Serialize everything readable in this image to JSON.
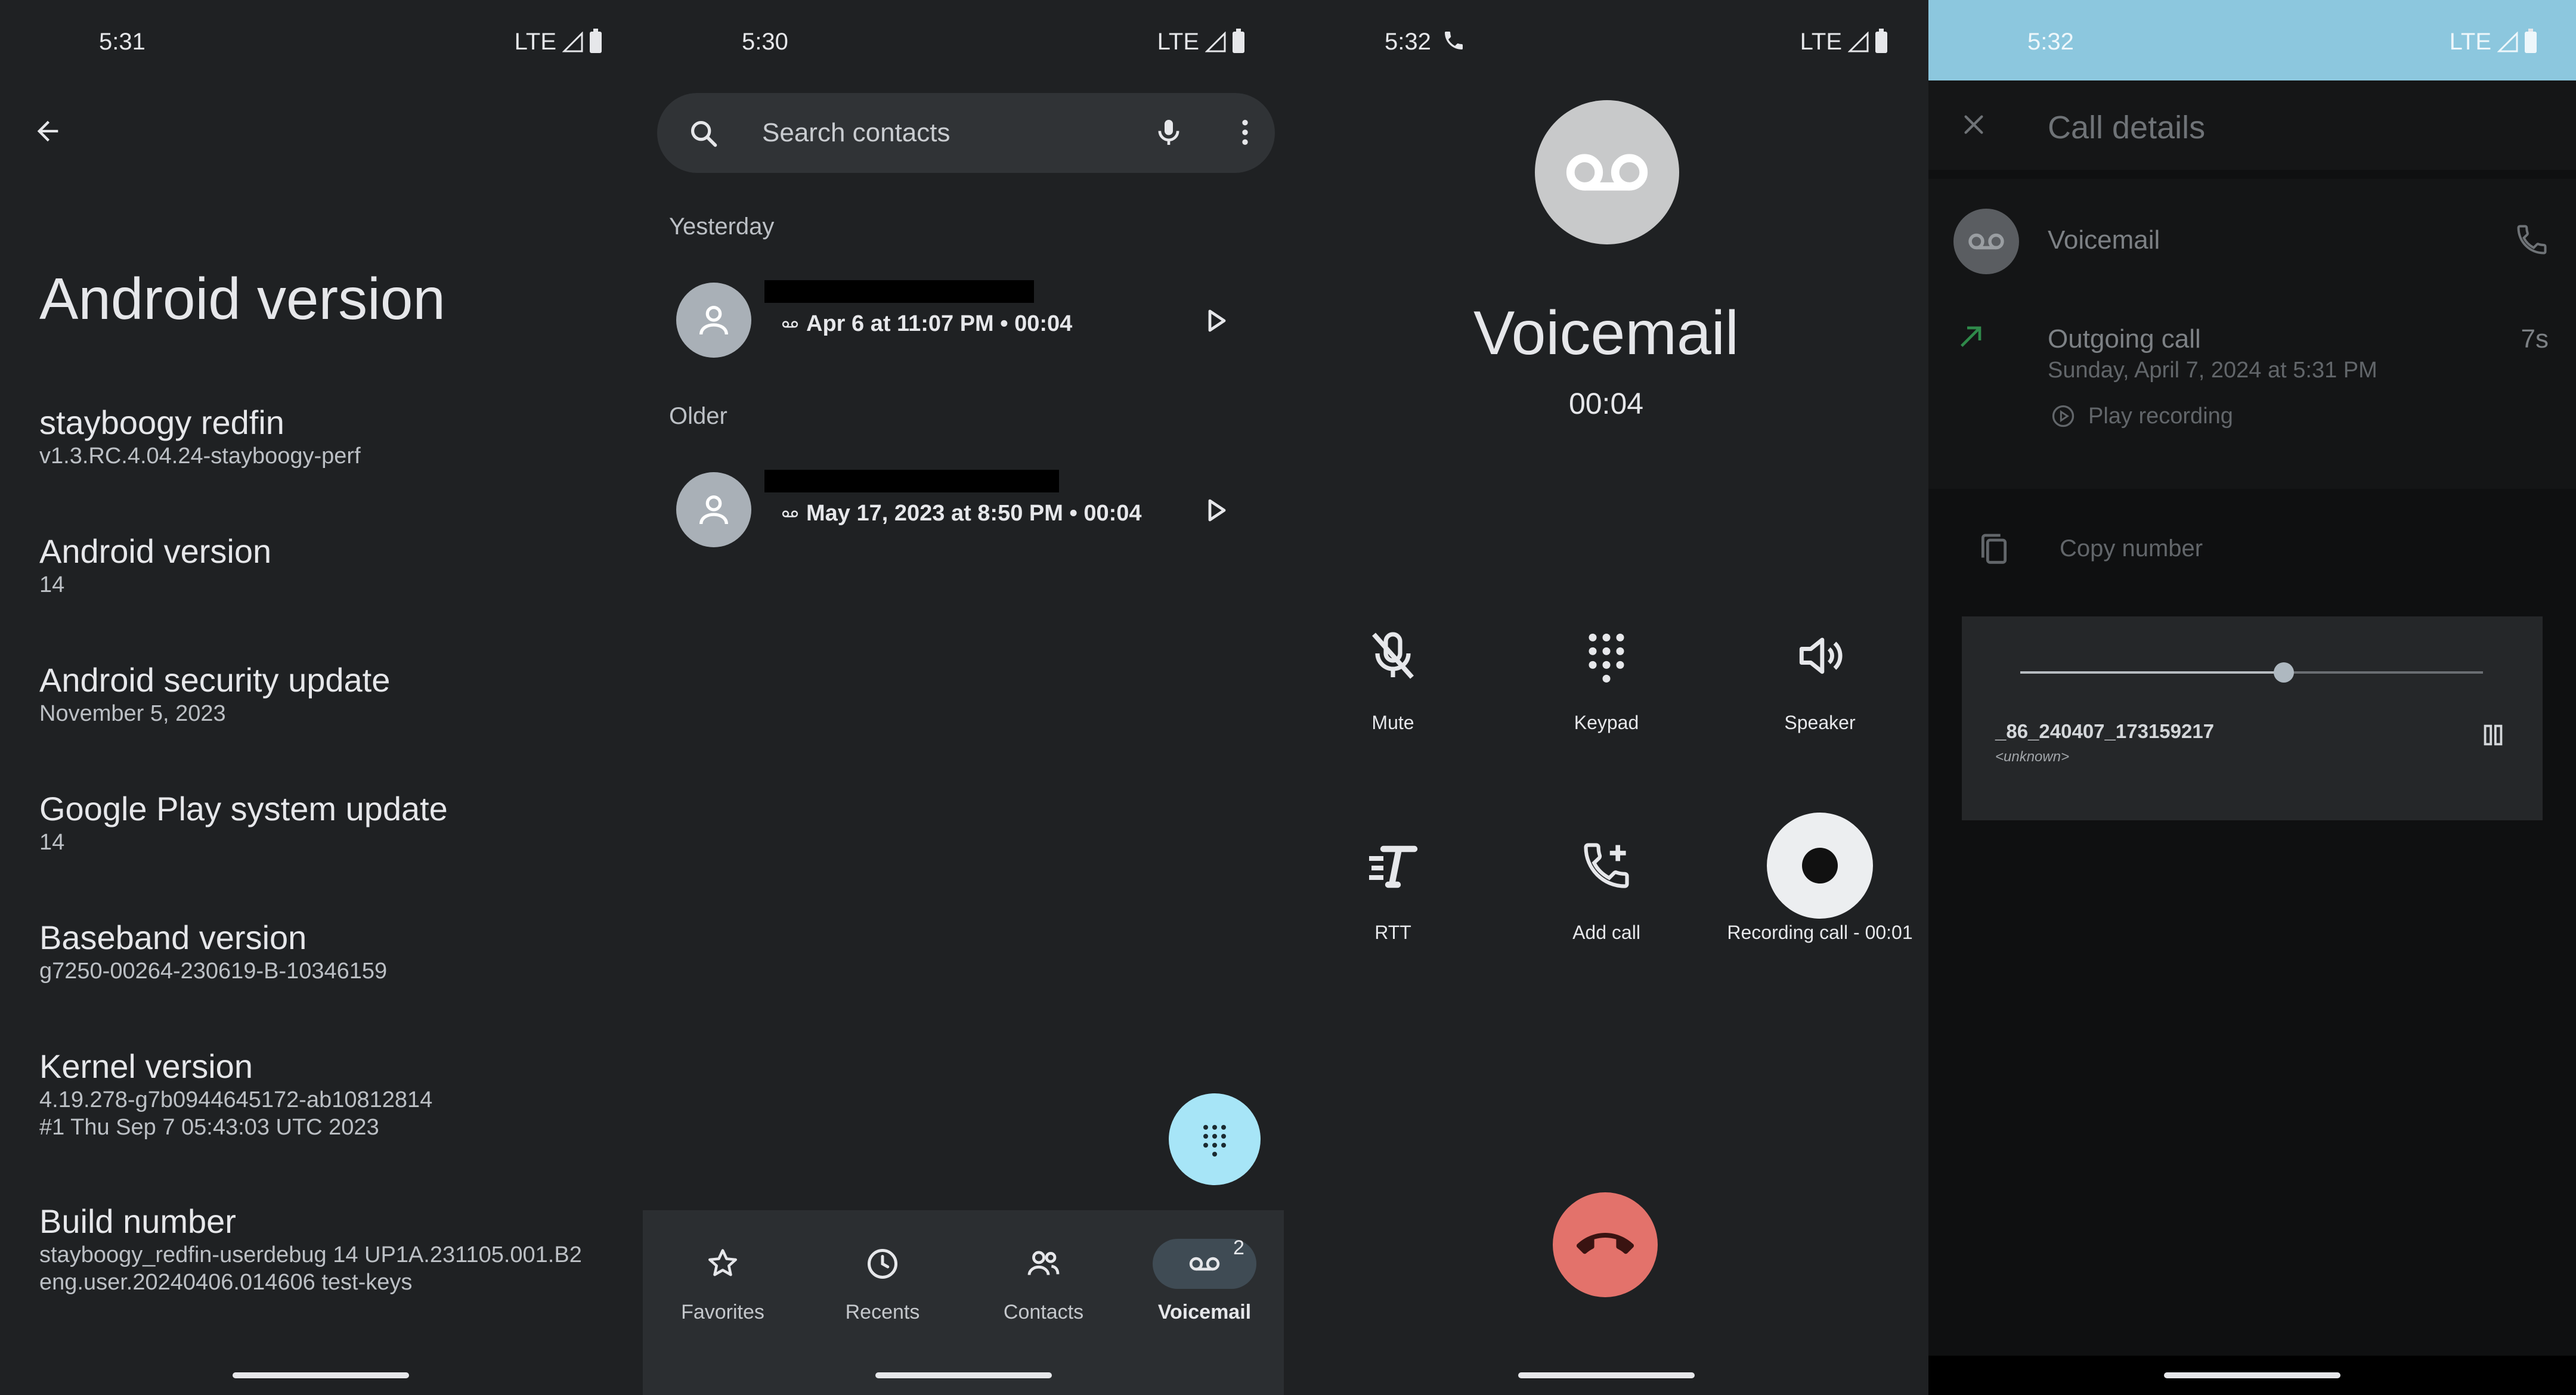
{
  "colors": {
    "background": "#1f2123",
    "text_primary": "#e6e7ea",
    "text_secondary": "#bcc0c5",
    "fab_accent": "#a7e5f7",
    "end_call": "#e3726b",
    "status_bar_p4": "#8cc7de"
  },
  "about_panel": {
    "status_time": "5:31",
    "status_network": "LTE",
    "title": "Android version",
    "items": [
      {
        "title": "stayboogy redfin",
        "subtitle": "v1.3.RC.4.04.24-stayboogy-perf"
      },
      {
        "title": "Android version",
        "subtitle": "14"
      },
      {
        "title": "Android security update",
        "subtitle": "November 5, 2023"
      },
      {
        "title": "Google Play system update",
        "subtitle": "14"
      },
      {
        "title": "Baseband version",
        "subtitle": "g7250-00264-230619-B-10346159"
      },
      {
        "title": "Kernel version",
        "subtitle": "4.19.278-g7b0944645172-ab10812814",
        "subtitle2": "#1 Thu Sep 7 05:43:03 UTC 2023"
      },
      {
        "title": "Build number",
        "subtitle": "stayboogy_redfin-userdebug 14 UP1A.231105.001.B2",
        "subtitle2": "eng.user.20240406.014606 test-keys"
      }
    ]
  },
  "voicemail_panel": {
    "status_time": "5:30",
    "status_network": "LTE",
    "search_placeholder": "Search contacts",
    "sections": [
      {
        "label": "Yesterday",
        "entry_meta": "Apr 6 at 11:07 PM • 00:04"
      },
      {
        "label": "Older",
        "entry_meta": "May 17, 2023 at 8:50 PM • 00:04"
      }
    ],
    "bottom_nav": [
      {
        "label": "Favorites",
        "icon": "star-icon"
      },
      {
        "label": "Recents",
        "icon": "clock-icon"
      },
      {
        "label": "Contacts",
        "icon": "people-icon"
      },
      {
        "label": "Voicemail",
        "icon": "voicemail-icon",
        "badge": "2",
        "active": true
      }
    ]
  },
  "call_panel": {
    "status_time": "5:32",
    "status_network": "LTE",
    "caller_name": "Voicemail",
    "timer": "00:04",
    "controls": [
      {
        "label": "Mute",
        "icon": "mic-off-icon"
      },
      {
        "label": "Keypad",
        "icon": "dialpad-icon"
      },
      {
        "label": "Speaker",
        "icon": "speaker-icon"
      },
      {
        "label": "RTT",
        "icon": "rtt-icon"
      },
      {
        "label": "Add call",
        "icon": "add-call-icon"
      },
      {
        "label": "Recording call - 00:01",
        "icon": "record-icon"
      }
    ]
  },
  "details_panel": {
    "status_time": "5:32",
    "status_network": "LTE",
    "title": "Call details",
    "contact_name": "Voicemail",
    "call_type": "Outgoing call",
    "call_date": "Sunday, April 7, 2024 at 5:31 PM",
    "call_duration": "7s",
    "play_recording": "Play recording",
    "copy_number": "Copy number",
    "player": {
      "file_name": "_86_240407_173159217",
      "file_sub": "<unknown>",
      "progress": 0.57
    }
  }
}
